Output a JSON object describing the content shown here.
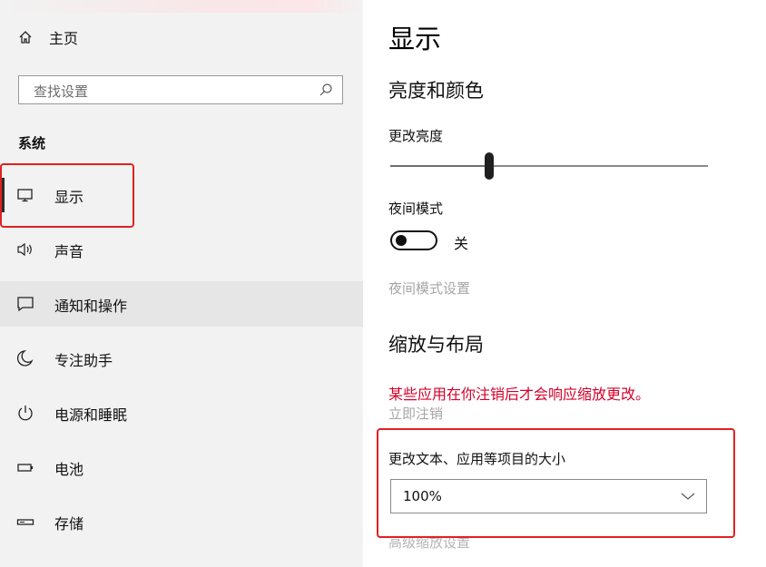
{
  "sidebar": {
    "home_label": "主页",
    "search_placeholder": "查找设置",
    "section_label": "系统",
    "items": [
      {
        "label": "显示",
        "icon": "monitor-icon"
      },
      {
        "label": "声音",
        "icon": "speaker-icon"
      },
      {
        "label": "通知和操作",
        "icon": "notification-icon"
      },
      {
        "label": "专注助手",
        "icon": "moon-icon"
      },
      {
        "label": "电源和睡眠",
        "icon": "power-icon"
      },
      {
        "label": "电池",
        "icon": "battery-icon"
      },
      {
        "label": "存储",
        "icon": "storage-icon"
      }
    ]
  },
  "main": {
    "title": "显示",
    "brightness_section": "亮度和颜色",
    "brightness_label": "更改亮度",
    "brightness_level": 0.31,
    "night_mode_label": "夜间模式",
    "night_mode_state": "关",
    "night_mode_settings_link": "夜间模式设置",
    "scale_section": "缩放与布局",
    "warning_text": "某些应用在你注销后才会响应缩放更改。",
    "sign_out_link": "立即注销",
    "scale_label": "更改文本、应用等项目的大小",
    "scale_value": "100%",
    "advanced_scale_link": "高级缩放设置"
  },
  "colors": {
    "accent_warning": "#d4002a",
    "annotation_red": "#e02020",
    "sidebar_bg": "#f2f2f2"
  }
}
